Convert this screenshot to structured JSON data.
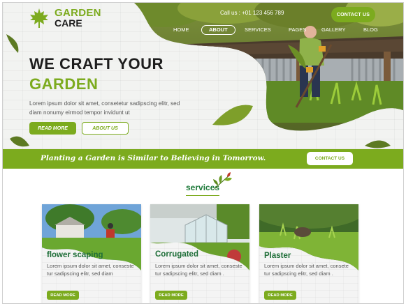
{
  "brand": {
    "line1": "GARDEN",
    "line2": "CARE",
    "accent_color": "#7cab1e",
    "logo_icon": "maple-leaf-icon"
  },
  "header": {
    "call_text": "Call us : +01 123 456 789",
    "contact_button": "CONTACT US",
    "nav": [
      {
        "label": "HOME",
        "active": false
      },
      {
        "label": "ABOUT",
        "active": true
      },
      {
        "label": "SERVICES",
        "active": false
      },
      {
        "label": "PAGES",
        "active": false
      },
      {
        "label": "GALLERY",
        "active": false
      },
      {
        "label": "BLOG",
        "active": false
      }
    ]
  },
  "hero": {
    "headline_line1": "WE CRAFT YOUR",
    "headline_line2": "GARDEN",
    "text": "Lorem ipsum dolor sit amet, consetetur sadipscing elitr, sed diam nonumy eirmod tempor invidunt ut",
    "read_more": "READ MORE",
    "about_us": "ABOUT US"
  },
  "banner": {
    "text": "Planting a Garden is Similar to Believing in Tomorrow.",
    "button": "CONTACT US"
  },
  "services": {
    "title": "services",
    "cards": [
      {
        "title": "flower scaping",
        "text": "Lorem ipsum dolor sit amet, conseste tur sadipscing elitr, sed diam",
        "button": "READ MORE"
      },
      {
        "title": "Corrugated",
        "text": "Lorem ipsum dolor sit amet, conseste tur sadipscing elitr, sed diam .",
        "button": "READ MORE"
      },
      {
        "title": "Plaster",
        "text": "Lorem ipsum dolor sit amet, consete tur sadipscing elitr, sed diam .",
        "button": "READ MORE"
      }
    ]
  }
}
